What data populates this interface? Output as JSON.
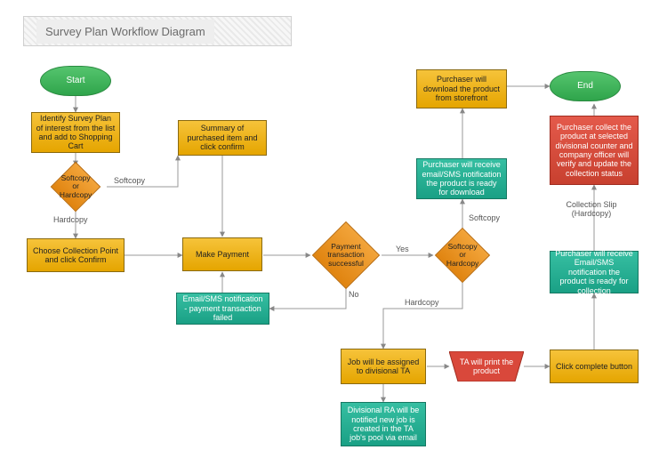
{
  "title": "Survey Plan Workflow Diagram",
  "nodes": {
    "start": "Start",
    "end": "End",
    "identify": "Identify Survey Plan of interest from the list and add to Shopping Cart",
    "choice1": "Softcopy or Hardcopy",
    "summary": "Summary of purchased item and click confirm",
    "choose": "Choose Collection Point and click Confirm",
    "make_payment": "Make Payment",
    "pay_success": "Payment transaction successful",
    "fail": "Email/SMS notification - payment transaction failed",
    "choice2": "Softcopy or Hardcopy",
    "download": "Purchaser will download the product from storefront",
    "soft_ready": "Purchaser will receive email/SMS notification the product is ready for download",
    "assign": "Job will be assigned to divisional TA",
    "ra_notify": "Divisional RA will be notified new job is created in the TA job's pool via email",
    "ta_print": "TA will print the product",
    "click_complete": "Click complete button",
    "hard_ready": "Purchaser will receive Email/SMS notification the product is ready for collection",
    "collect": "Purchaser collect the product at selected divisional counter and company officer will verify and update the collection status"
  },
  "edge_labels": {
    "softcopy1": "Softcopy",
    "hardcopy1": "Hardcopy",
    "yes": "Yes",
    "no": "No",
    "softcopy2": "Softcopy",
    "hardcopy2": "Hardcopy",
    "slip": "Collection Slip (Hardcopy)"
  },
  "chart_data": {
    "type": "flowchart",
    "title": "Survey Plan Workflow Diagram",
    "nodes": [
      {
        "id": "start",
        "type": "terminator",
        "label": "Start"
      },
      {
        "id": "identify",
        "type": "process",
        "label": "Identify Survey Plan of interest from the list and add to Shopping Cart"
      },
      {
        "id": "choice1",
        "type": "decision",
        "label": "Softcopy or Hardcopy"
      },
      {
        "id": "summary",
        "type": "process",
        "label": "Summary of purchased item and click confirm"
      },
      {
        "id": "choose",
        "type": "process",
        "label": "Choose Collection Point and click Confirm"
      },
      {
        "id": "make_payment",
        "type": "process",
        "label": "Make Payment"
      },
      {
        "id": "pay_success",
        "type": "decision",
        "label": "Payment transaction successful"
      },
      {
        "id": "fail",
        "type": "process",
        "label": "Email/SMS notification - payment transaction failed"
      },
      {
        "id": "choice2",
        "type": "decision",
        "label": "Softcopy or Hardcopy"
      },
      {
        "id": "soft_ready",
        "type": "process",
        "label": "Purchaser will receive email/SMS notification the product is ready for download"
      },
      {
        "id": "download",
        "type": "process",
        "label": "Purchaser will download the product from storefront"
      },
      {
        "id": "assign",
        "type": "process",
        "label": "Job will be assigned to divisional TA"
      },
      {
        "id": "ra_notify",
        "type": "process",
        "label": "Divisional RA will be notified new job is created in the TA job's pool via email"
      },
      {
        "id": "ta_print",
        "type": "manual-op",
        "label": "TA will print the product"
      },
      {
        "id": "click_complete",
        "type": "process",
        "label": "Click complete button"
      },
      {
        "id": "hard_ready",
        "type": "process",
        "label": "Purchaser will receive Email/SMS notification the product is ready for collection"
      },
      {
        "id": "collect",
        "type": "process",
        "label": "Purchaser collect the product at selected divisional counter and company officer will verify and update the collection status"
      },
      {
        "id": "end",
        "type": "terminator",
        "label": "End"
      }
    ],
    "edges": [
      {
        "from": "start",
        "to": "identify"
      },
      {
        "from": "identify",
        "to": "choice1"
      },
      {
        "from": "choice1",
        "to": "summary",
        "label": "Softcopy"
      },
      {
        "from": "choice1",
        "to": "choose",
        "label": "Hardcopy"
      },
      {
        "from": "choose",
        "to": "make_payment"
      },
      {
        "from": "summary",
        "to": "make_payment"
      },
      {
        "from": "make_payment",
        "to": "pay_success"
      },
      {
        "from": "pay_success",
        "to": "choice2",
        "label": "Yes"
      },
      {
        "from": "pay_success",
        "to": "fail",
        "label": "No"
      },
      {
        "from": "fail",
        "to": "make_payment"
      },
      {
        "from": "choice2",
        "to": "soft_ready",
        "label": "Softcopy"
      },
      {
        "from": "soft_ready",
        "to": "download"
      },
      {
        "from": "download",
        "to": "end"
      },
      {
        "from": "choice2",
        "to": "assign",
        "label": "Hardcopy"
      },
      {
        "from": "assign",
        "to": "ra_notify"
      },
      {
        "from": "assign",
        "to": "ta_print"
      },
      {
        "from": "ta_print",
        "to": "click_complete"
      },
      {
        "from": "click_complete",
        "to": "hard_ready"
      },
      {
        "from": "hard_ready",
        "to": "collect",
        "label": "Collection Slip (Hardcopy)"
      },
      {
        "from": "collect",
        "to": "end"
      }
    ]
  }
}
